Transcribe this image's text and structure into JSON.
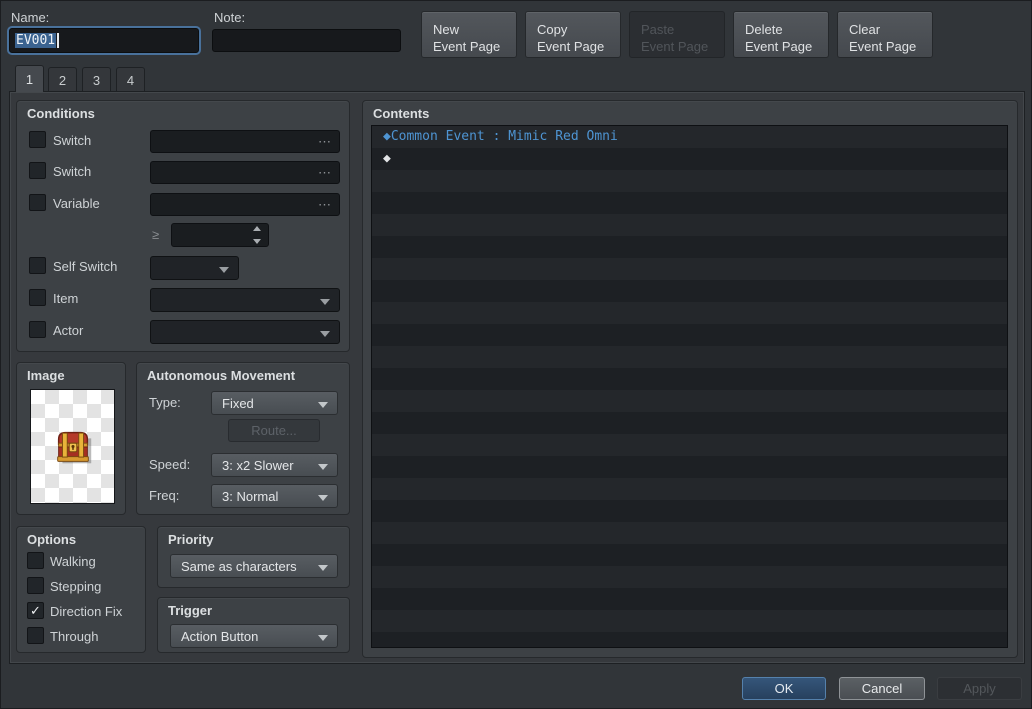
{
  "header": {
    "name_label": "Name:",
    "name_value": "EV001",
    "note_label": "Note:",
    "note_value": "",
    "page_buttons": [
      {
        "line1": "New",
        "line2": "Event Page"
      },
      {
        "line1": "Copy",
        "line2": "Event Page"
      },
      {
        "line1": "Paste",
        "line2": "Event Page"
      },
      {
        "line1": "Delete",
        "line2": "Event Page"
      },
      {
        "line1": "Clear",
        "line2": "Event Page"
      }
    ]
  },
  "tabs": {
    "labels": [
      "1",
      "2",
      "3",
      "4"
    ],
    "active": "1"
  },
  "conditions": {
    "title": "Conditions",
    "ellipsis": "⋯",
    "switch1_label": "Switch",
    "switch1_mark": "",
    "switch1_value": "",
    "switch2_label": "Switch",
    "switch2_mark": "",
    "switch2_value": "",
    "variable_label": "Variable",
    "variable_mark": "",
    "variable_value": "",
    "comparator": "≥",
    "variable_amount": "",
    "self_switch_label": "Self Switch",
    "self_switch_mark": "",
    "self_switch_value": "",
    "item_label": "Item",
    "item_mark": "",
    "item_value": "",
    "actor_label": "Actor",
    "actor_mark": "",
    "actor_value": ""
  },
  "image_panel": {
    "title": "Image",
    "sprite": "treasure-chest-icon"
  },
  "movement": {
    "title": "Autonomous Movement",
    "type_label": "Type:",
    "type_value": "Fixed",
    "route_label": "Route...",
    "speed_label": "Speed:",
    "speed_value": "3: x2 Slower",
    "freq_label": "Freq:",
    "freq_value": "3: Normal"
  },
  "options": {
    "title": "Options",
    "items": [
      {
        "label": "Walking",
        "mark": ""
      },
      {
        "label": "Stepping",
        "mark": ""
      },
      {
        "label": "Direction Fix",
        "mark": "✓"
      },
      {
        "label": "Through",
        "mark": ""
      }
    ]
  },
  "priority": {
    "title": "Priority",
    "value": "Same as characters"
  },
  "trigger": {
    "title": "Trigger",
    "value": "Action Button"
  },
  "contents": {
    "title": "Contents",
    "lines": [
      {
        "bullet": "◆",
        "text": "Common Event : Mimic Red Omni"
      },
      {
        "bullet": "◆",
        "text": ""
      }
    ]
  },
  "footer": {
    "ok": "OK",
    "cancel": "Cancel",
    "apply": "Apply"
  },
  "colors": {
    "accent_blue": "#4e94d2",
    "focus_border": "#49719b",
    "selection": "#3b6390",
    "ok_button": "#2d4b6e"
  }
}
